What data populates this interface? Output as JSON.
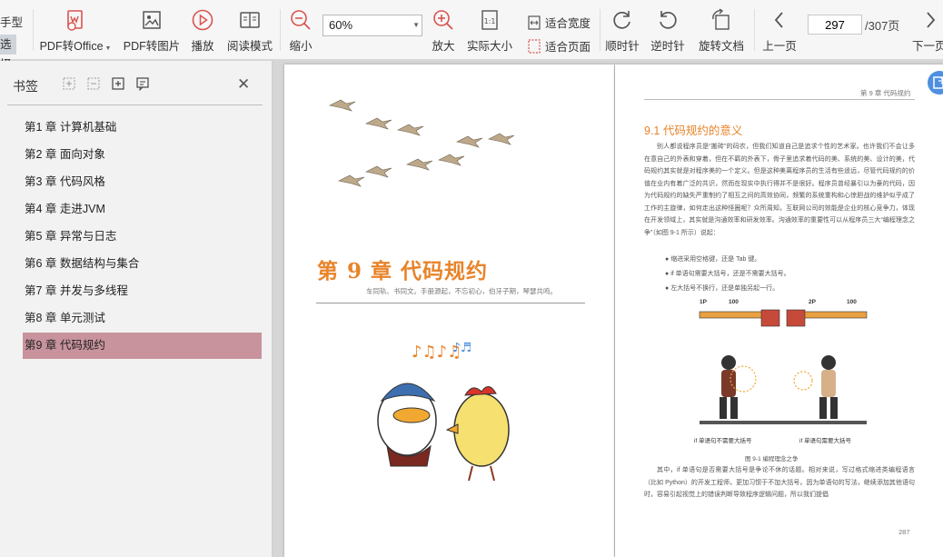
{
  "toolbar": {
    "edge_top_label": "手型",
    "edge_bottom_label": "选择",
    "pdf_to_office": "PDF转Office",
    "pdf_to_image": "PDF转图片",
    "play": "播放",
    "reading_mode": "阅读模式",
    "zoom_out": "缩小",
    "zoom_value": "60%",
    "zoom_in": "放大",
    "actual_size": "实际大小",
    "fit_width": "适合宽度",
    "fit_page": "适合页面",
    "rotate_cw": "顺时针",
    "rotate_ccw": "逆时针",
    "rotate_doc": "旋转文档",
    "prev_page": "上一页",
    "next_page": "下一页",
    "current_page": "297",
    "total_pages": "/307页"
  },
  "sidebar": {
    "title": "书签",
    "bookmarks": [
      {
        "label": "第1 章 计算机基础"
      },
      {
        "label": "第2 章 面向对象"
      },
      {
        "label": "第3 章 代码风格"
      },
      {
        "label": "第4 章 走进JVM"
      },
      {
        "label": "第5 章 异常与日志"
      },
      {
        "label": "第6 章 数据结构与集合"
      },
      {
        "label": "第7 章 并发与多线程"
      },
      {
        "label": "第8 章 单元测试"
      },
      {
        "label": "第9 章 代码规约",
        "active": true
      }
    ]
  },
  "document": {
    "left": {
      "chapter_title": "第 9 章   代码规约",
      "chapter_subtitle": "车同轨、书同文。手册源起，不忘初心，伯牙子期，琴瑟共鸣。"
    },
    "right": {
      "running_head": "第 9 章   代码规约",
      "section_title": "9.1   代码规约的意义",
      "paragraph_1": "别人都说程序员是“搬砖”的码农，但我们知道自己是追求个性的艺术家。也许我们不会让多在意自己的外表和穿着，但在不羁的外表下，骨子里追求着代码的美、系统的美、设计的美，代码规约其实就是对程序美的一个定义。但是这种美离程序员的生活有些遥远，尽管代码规约的价值在业内有着广泛的共识，然而在现实中执行得并不是很好。程序员曾经暴引以为豪的代码，因为代码规约的缺失严重制约了相互之间的高效协同，频繁的系统重构和心惊胆战的维护似乎成了工作的主旋律，如何走出这种怪圈呢？众所周知，互联网公司的效能是企业的核心竞争力，体现在开发领域上，其实就是沟通效率和研发效率。沟通效率的重要性可以从程序员三大“编程理念之争”（如图 9-1 所示）说起：",
      "bullets": [
        "缩进采用空格键，还是 Tab 键。",
        "if 单语句需要大括号，还是不需要大括号。",
        "左大括号不换行，还是单独另起一行。"
      ],
      "figure": {
        "p1": "1P",
        "p1_score": "100",
        "p2": "2P",
        "p2_score": "100",
        "left_label": "if 单语句不需要大括号",
        "right_label": "if 单语句需要大括号"
      },
      "figure_caption": "图 9-1   编程理念之争",
      "paragraph_2": "其中，if 单语句是否需要大括号是争论不休的话题。相对来说，写过格式缩进类编程语言（比如 Python）的开发工程师，更加习惯于不加大括号。因为单语句的写法，继续添加其他语句时，容易引起视觉上的错误判断导致程序逻辑问题，所以我们提倡",
      "page_number": "287"
    }
  },
  "colors": {
    "accent_orange": "#e8842a",
    "bookmark_active": "#c8939d",
    "toolbar_red": "#d9534f"
  }
}
